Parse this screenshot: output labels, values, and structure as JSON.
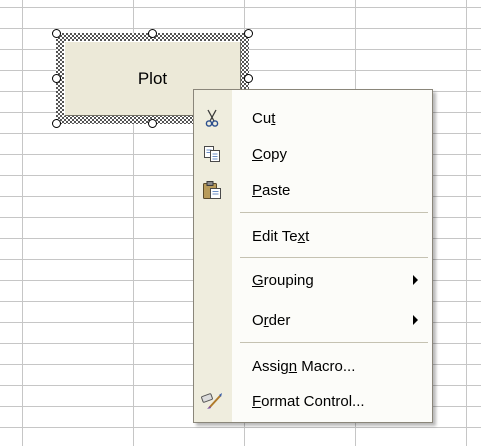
{
  "button_control": {
    "label": "Plot"
  },
  "context_menu": {
    "items": [
      {
        "label": "Cut",
        "mnemonic_index": 2,
        "icon": "scissors-icon"
      },
      {
        "label": "Copy",
        "mnemonic_index": 0,
        "icon": "copy-icon"
      },
      {
        "label": "Paste",
        "mnemonic_index": 0,
        "icon": "paste-icon"
      },
      {
        "label": "Edit Text",
        "mnemonic_index": 7
      },
      {
        "label": "Grouping",
        "mnemonic_index": 0,
        "submenu": true
      },
      {
        "label": "Order",
        "mnemonic_index": 1,
        "submenu": true
      },
      {
        "label": "Assign Macro...",
        "mnemonic_index": 5
      },
      {
        "label": "Format Control...",
        "mnemonic_index": 0,
        "icon": "format-control-icon"
      }
    ]
  }
}
